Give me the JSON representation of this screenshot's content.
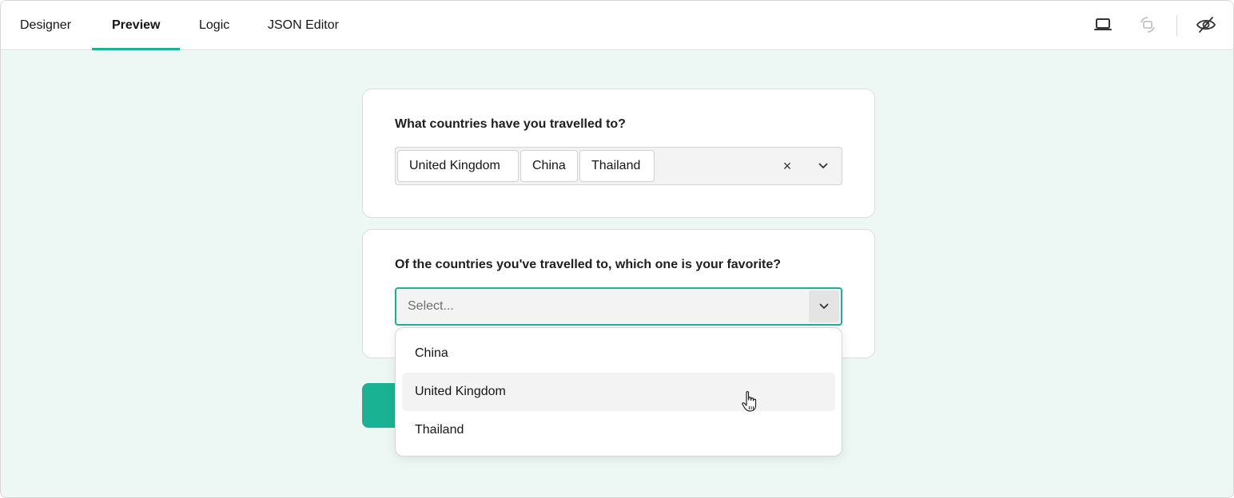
{
  "tabs": {
    "designer": "Designer",
    "preview": "Preview",
    "logic": "Logic",
    "json_editor": "JSON Editor"
  },
  "toolbar_icons": [
    "laptop-icon",
    "rotate-device-icon",
    "eye-off-icon"
  ],
  "question1": {
    "title": "What countries have you travelled to?",
    "tags": [
      "United Kingdom",
      "China",
      "Thailand"
    ],
    "clear_glyph": "×"
  },
  "question2": {
    "title": "Of the countries you've travelled to, which one is your favorite?",
    "placeholder": "Select..."
  },
  "dropdown": {
    "options": [
      "China",
      "United Kingdom",
      "Thailand"
    ],
    "hovered": "United Kingdom"
  },
  "colors": {
    "accent": "#19b394",
    "background": "#edf7f4"
  }
}
